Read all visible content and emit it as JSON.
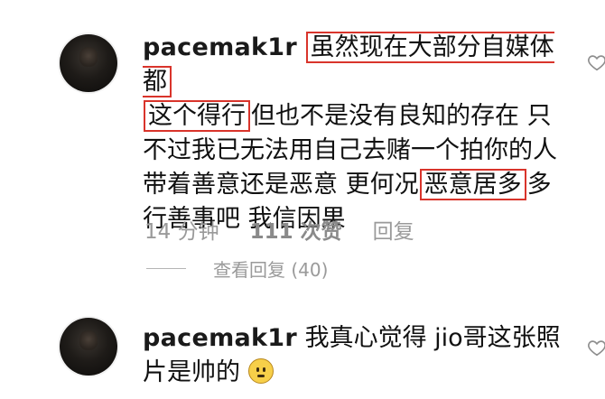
{
  "comments": [
    {
      "username": "pacemak1r",
      "segments": [
        {
          "text": "虽然现在大部分自媒体都",
          "highlight": true
        },
        {
          "text": "\n",
          "highlight": false
        },
        {
          "text": "这个得行",
          "highlight": true
        },
        {
          "text": "但也不是没有良知的存在 只不过我已无法用自己去赌一个拍你的人带着善意还是恶意 更何况",
          "highlight": false
        },
        {
          "text": "恶意居多",
          "highlight": true
        },
        {
          "text": "多行善事吧 我信因果",
          "highlight": false
        }
      ],
      "time": "14 分钟",
      "likes": "111 次赞",
      "reply": "回复",
      "view_replies": "查看回复 (40)"
    },
    {
      "username": "pacemak1r",
      "text": "我真心觉得 jio哥这张照片是帅的",
      "emoji": "slightly-frowning-face"
    }
  ],
  "colors": {
    "highlight_border": "#d9342b",
    "meta_text": "#9a9a9a"
  }
}
